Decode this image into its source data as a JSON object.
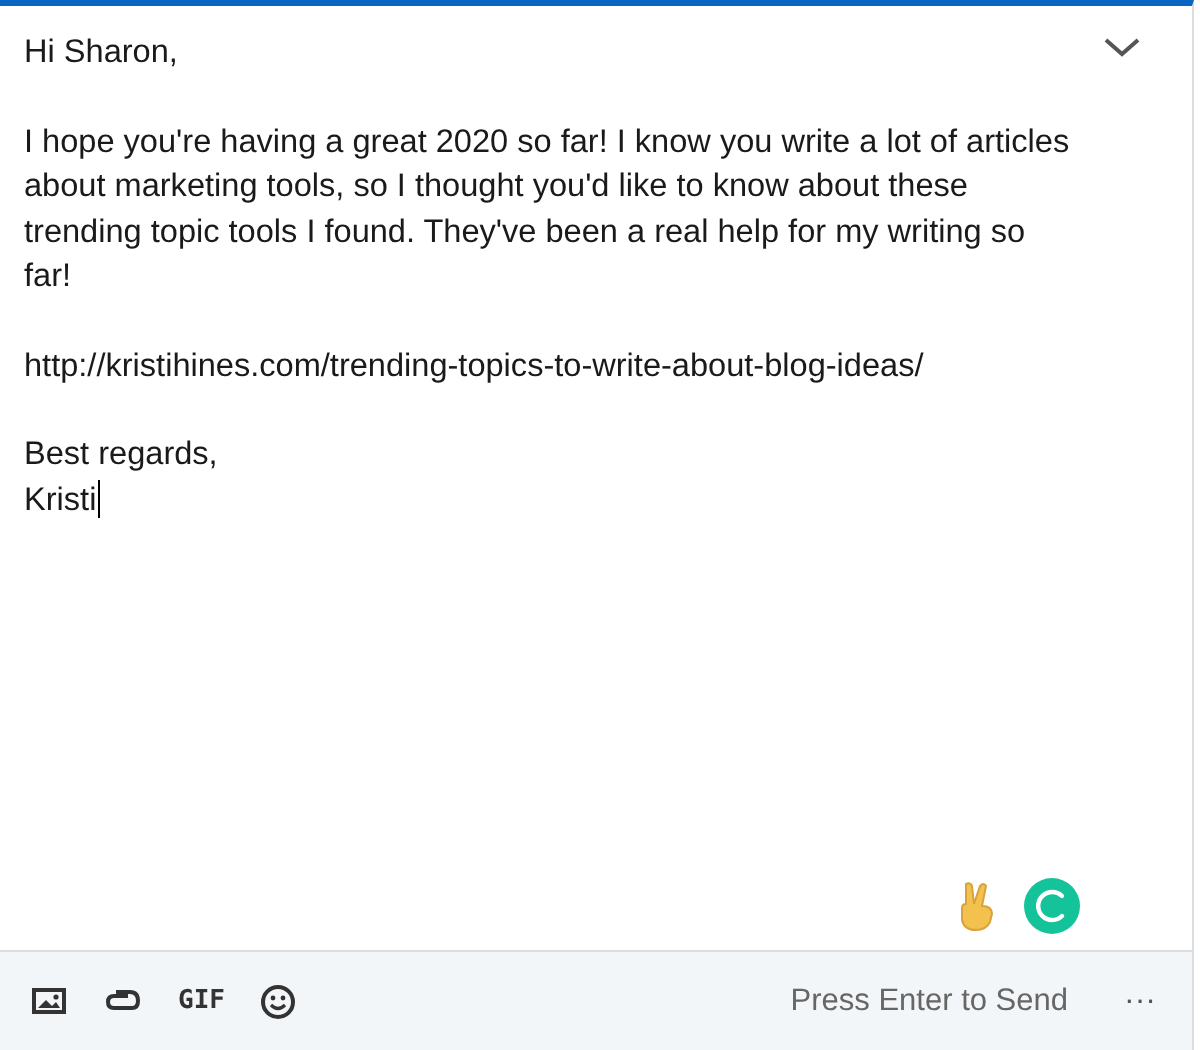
{
  "message": {
    "paragraphs": [
      "Hi Sharon,",
      "I hope you're having a great 2020 so far! I know you write a lot of articles about marketing tools, so I thought you'd like to know about these trending topic tools I found. They've been a real help for my writing so far!",
      "http://kristihines.com/trending-topics-to-write-about-blog-ideas/"
    ],
    "closing": [
      "Best regards,",
      "Kristi"
    ]
  },
  "toolbar": {
    "gif": "GIF",
    "send_hint": "Press Enter to Send",
    "more": "···"
  }
}
